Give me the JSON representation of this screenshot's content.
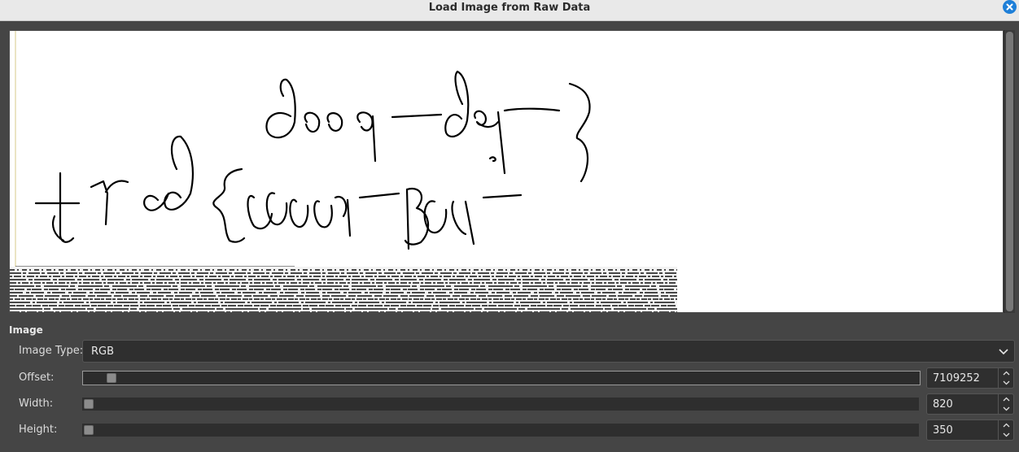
{
  "window": {
    "title": "Load Image from Raw Data",
    "close_icon": "close-icon",
    "accent": "#1e7fd8"
  },
  "preview": {
    "description_icon": "raw-image-preview"
  },
  "image_section": {
    "label": "Image",
    "image_type": {
      "label": "Image Type:",
      "value": "RGB",
      "icon": "chevron-down-icon"
    },
    "offset": {
      "label": "Offset:",
      "value": "7109252"
    },
    "width": {
      "label": "Width:",
      "value": "820"
    },
    "height": {
      "label": "Height:",
      "value": "350"
    }
  }
}
